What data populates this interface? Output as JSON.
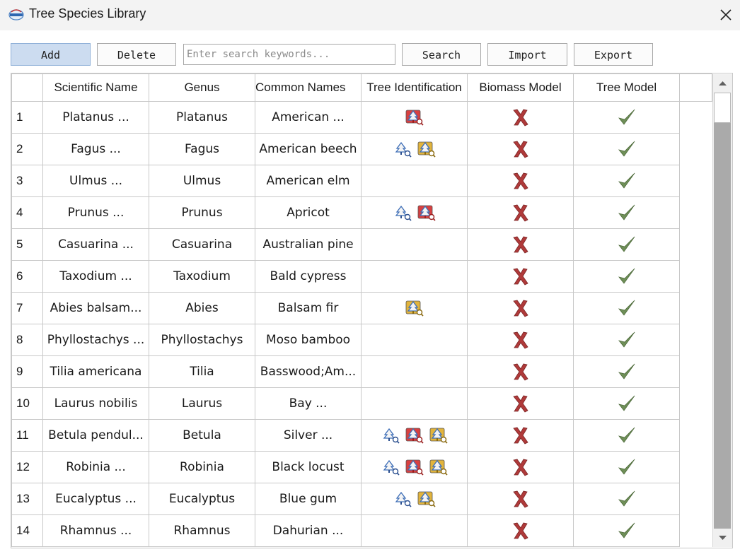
{
  "window": {
    "title": "Tree Species Library",
    "app_icon": "lidar-logo-icon",
    "close_icon": "close-icon"
  },
  "toolbar": {
    "add_label": "Add",
    "delete_label": "Delete",
    "search_placeholder": "Enter search keywords...",
    "search_value": "",
    "search_label": "Search",
    "import_label": "Import",
    "export_label": "Export"
  },
  "table": {
    "columns": [
      "",
      "Scientific Name",
      "Genus",
      "Common Names",
      "Tree Identification",
      "Biomass Model",
      "Tree Model"
    ],
    "rows": [
      {
        "num": "1",
        "sci": "Platanus ...",
        "genus": "Platanus",
        "common": "American ...",
        "ident": [
          "red"
        ],
        "biomass": false,
        "tree_model": true
      },
      {
        "num": "2",
        "sci": "Fagus ...",
        "genus": "Fagus",
        "common": "American beech",
        "ident": [
          "blue",
          "yellow"
        ],
        "biomass": false,
        "tree_model": true
      },
      {
        "num": "3",
        "sci": "Ulmus ...",
        "genus": "Ulmus",
        "common": "American elm",
        "ident": [],
        "biomass": false,
        "tree_model": true
      },
      {
        "num": "4",
        "sci": "Prunus ...",
        "genus": "Prunus",
        "common": "Apricot",
        "ident": [
          "blue",
          "red"
        ],
        "biomass": false,
        "tree_model": true
      },
      {
        "num": "5",
        "sci": "Casuarina ...",
        "genus": "Casuarina",
        "common": "Australian pine",
        "ident": [],
        "biomass": false,
        "tree_model": true
      },
      {
        "num": "6",
        "sci": "Taxodium ...",
        "genus": "Taxodium",
        "common": "Bald cypress",
        "ident": [],
        "biomass": false,
        "tree_model": true
      },
      {
        "num": "7",
        "sci": "Abies balsam...",
        "genus": "Abies",
        "common": "Balsam fir",
        "ident": [
          "yellow"
        ],
        "biomass": false,
        "tree_model": true
      },
      {
        "num": "8",
        "sci": "Phyllostachys ...",
        "genus": "Phyllostachys",
        "common": "Moso bamboo",
        "ident": [],
        "biomass": false,
        "tree_model": true
      },
      {
        "num": "9",
        "sci": "Tilia americana",
        "genus": "Tilia",
        "common": "Basswood;Am...",
        "ident": [],
        "biomass": false,
        "tree_model": true
      },
      {
        "num": "10",
        "sci": "Laurus nobilis",
        "genus": "Laurus",
        "common": "Bay ...",
        "ident": [],
        "biomass": false,
        "tree_model": true
      },
      {
        "num": "11",
        "sci": "Betula pendul...",
        "genus": "Betula",
        "common": "Silver ...",
        "ident": [
          "blue",
          "red",
          "yellow"
        ],
        "biomass": false,
        "tree_model": true
      },
      {
        "num": "12",
        "sci": "Robinia ...",
        "genus": "Robinia",
        "common": "Black locust",
        "ident": [
          "blue",
          "red",
          "yellow"
        ],
        "biomass": false,
        "tree_model": true
      },
      {
        "num": "13",
        "sci": "Eucalyptus ...",
        "genus": "Eucalyptus",
        "common": "Blue gum",
        "ident": [
          "blue",
          "yellow"
        ],
        "biomass": false,
        "tree_model": true
      },
      {
        "num": "14",
        "sci": "Rhamnus ...",
        "genus": "Rhamnus",
        "common": "Dahurian ...",
        "ident": [],
        "biomass": false,
        "tree_model": true
      }
    ]
  },
  "icons": {
    "blue": "tree-scan-blue-icon",
    "red": "tree-scan-red-icon",
    "yellow": "tree-scan-yellow-icon",
    "check": "checkmark-icon",
    "cross": "cross-icon"
  },
  "colors": {
    "check": "#6f8f58",
    "cross": "#b03a3a",
    "add_button_bg": "#ccdcf0"
  }
}
